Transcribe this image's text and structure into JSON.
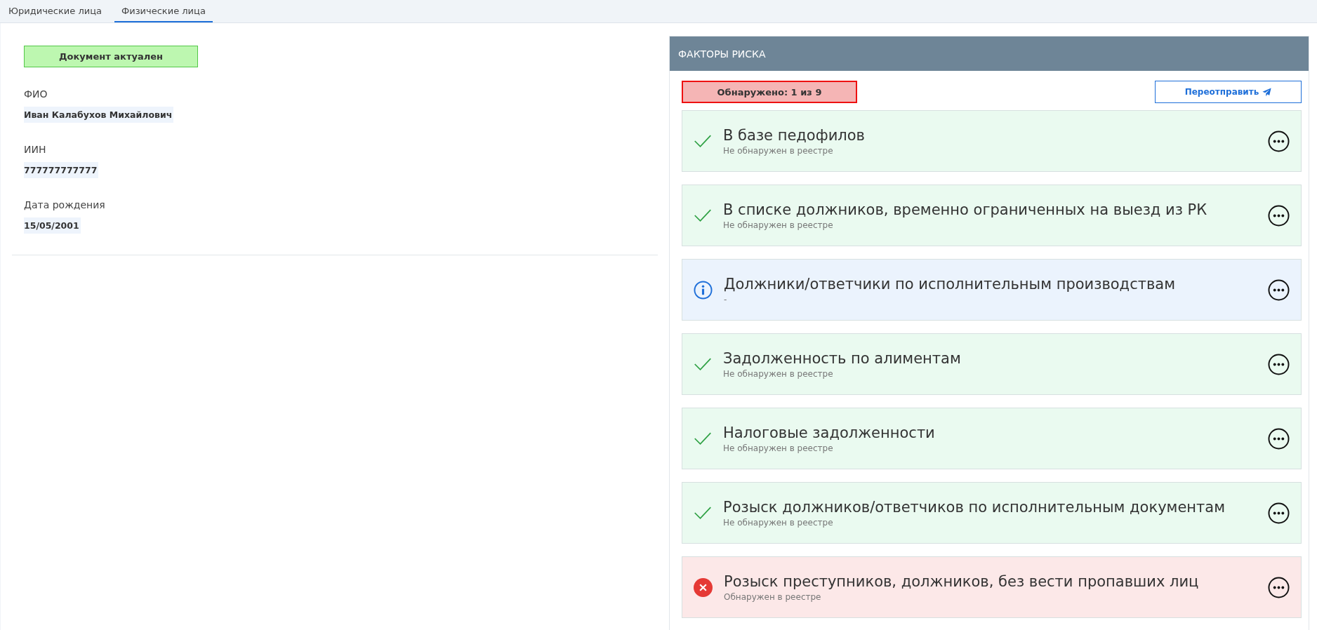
{
  "tabs": [
    {
      "label": "Юридические лица",
      "selected": false
    },
    {
      "label": "Физические лица",
      "selected": true
    }
  ],
  "person": {
    "status_badge": "Документ актуален",
    "fields": [
      {
        "label": "ФИО",
        "value": "Иван Калабухов Михайлович"
      },
      {
        "label": "ИИН",
        "value": "777777777777"
      },
      {
        "label": "Дата рождения",
        "value": "15/05/2001"
      }
    ]
  },
  "risk_factors": {
    "title": "ФАКТОРЫ РИСКА",
    "summary": "Обнаружено: 1 из 9",
    "resend_button": "Переотправить",
    "items": [
      {
        "kind": "ok",
        "title": "В базе педофилов",
        "subtitle": "Не обнаружен в реестре"
      },
      {
        "kind": "ok",
        "title": "В списке должников, временно ограниченных на выезд из РК",
        "subtitle": "Не обнаружен в реестре"
      },
      {
        "kind": "info",
        "title": "Должники/ответчики по исполнительным производствам",
        "subtitle": "-"
      },
      {
        "kind": "ok",
        "title": "Задолженность по алиментам",
        "subtitle": "Не обнаружен в реестре"
      },
      {
        "kind": "ok",
        "title": "Налоговые задолженности",
        "subtitle": "Не обнаружен в реестре"
      },
      {
        "kind": "ok",
        "title": "Розыск должников/ответчиков по исполнительным документам",
        "subtitle": "Не обнаружен в реестре"
      },
      {
        "kind": "found",
        "title": "Розыск преступников, должников, без вести пропавших лиц",
        "subtitle": "Обнаружен в реестре"
      }
    ]
  }
}
